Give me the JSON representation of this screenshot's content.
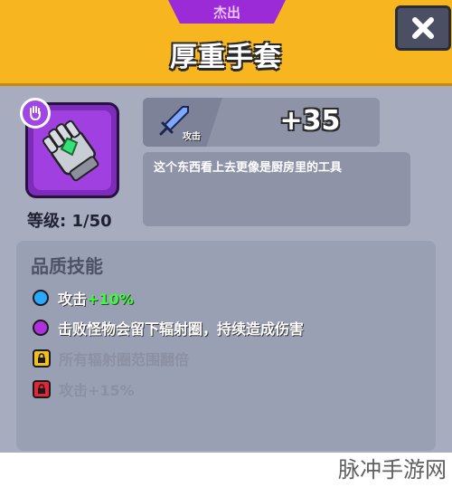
{
  "header": {
    "rarity": "杰出",
    "title": "厚重手套",
    "close_icon": "close-x-icon"
  },
  "item": {
    "icon": "heavy-glove-icon",
    "type_icon": "hand-icon",
    "level": "等级: 1/50"
  },
  "stat": {
    "icon": "sword-icon",
    "label": "攻击",
    "value": "+35"
  },
  "description": "这个东西看上去更像是厨房里的工具",
  "skills": {
    "title": "品质技能",
    "items": [
      {
        "label": "攻击",
        "highlight": "+10%",
        "marker": "blue-circle",
        "color": "#2aa7ff",
        "locked": false
      },
      {
        "label": "击败怪物会留下辐射圈，持续造成伤害",
        "highlight": "",
        "marker": "purple-circle",
        "color": "#b030e0",
        "locked": false
      },
      {
        "label": "所有辐射圈范围翻倍",
        "highlight": "",
        "marker": "yellow-lock",
        "color": "#f0c020",
        "locked": true
      },
      {
        "label": "攻击+15%",
        "highlight": "",
        "marker": "red-lock",
        "color": "#e02838",
        "locked": true
      }
    ]
  },
  "watermark": "脉冲手游网",
  "colors": {
    "header": "#f7b51f",
    "panel": "#a7acbf",
    "rarity": "#9b2bd6",
    "highlight": "#39ff3a"
  }
}
